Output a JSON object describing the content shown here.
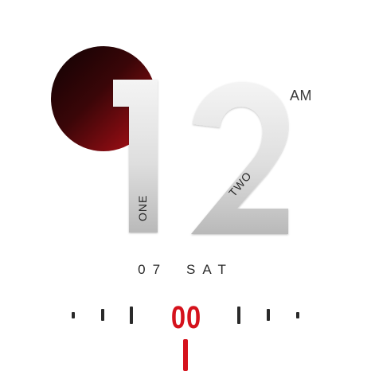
{
  "clock": {
    "hour_digit_1": "1",
    "hour_digit_2": "2",
    "hour_word_1": "ONE",
    "hour_word_2": "TWO",
    "ampm": "AM",
    "day_number": "07",
    "weekday": "SAT",
    "seconds": "00"
  },
  "colors": {
    "accent": "#d5121c",
    "disc_dark": "#0e0203",
    "disc_red": "#c4121b",
    "digit_light": "#f4f4f4",
    "digit_shade": "#bdbdbd",
    "text": "#2a2a2a"
  }
}
